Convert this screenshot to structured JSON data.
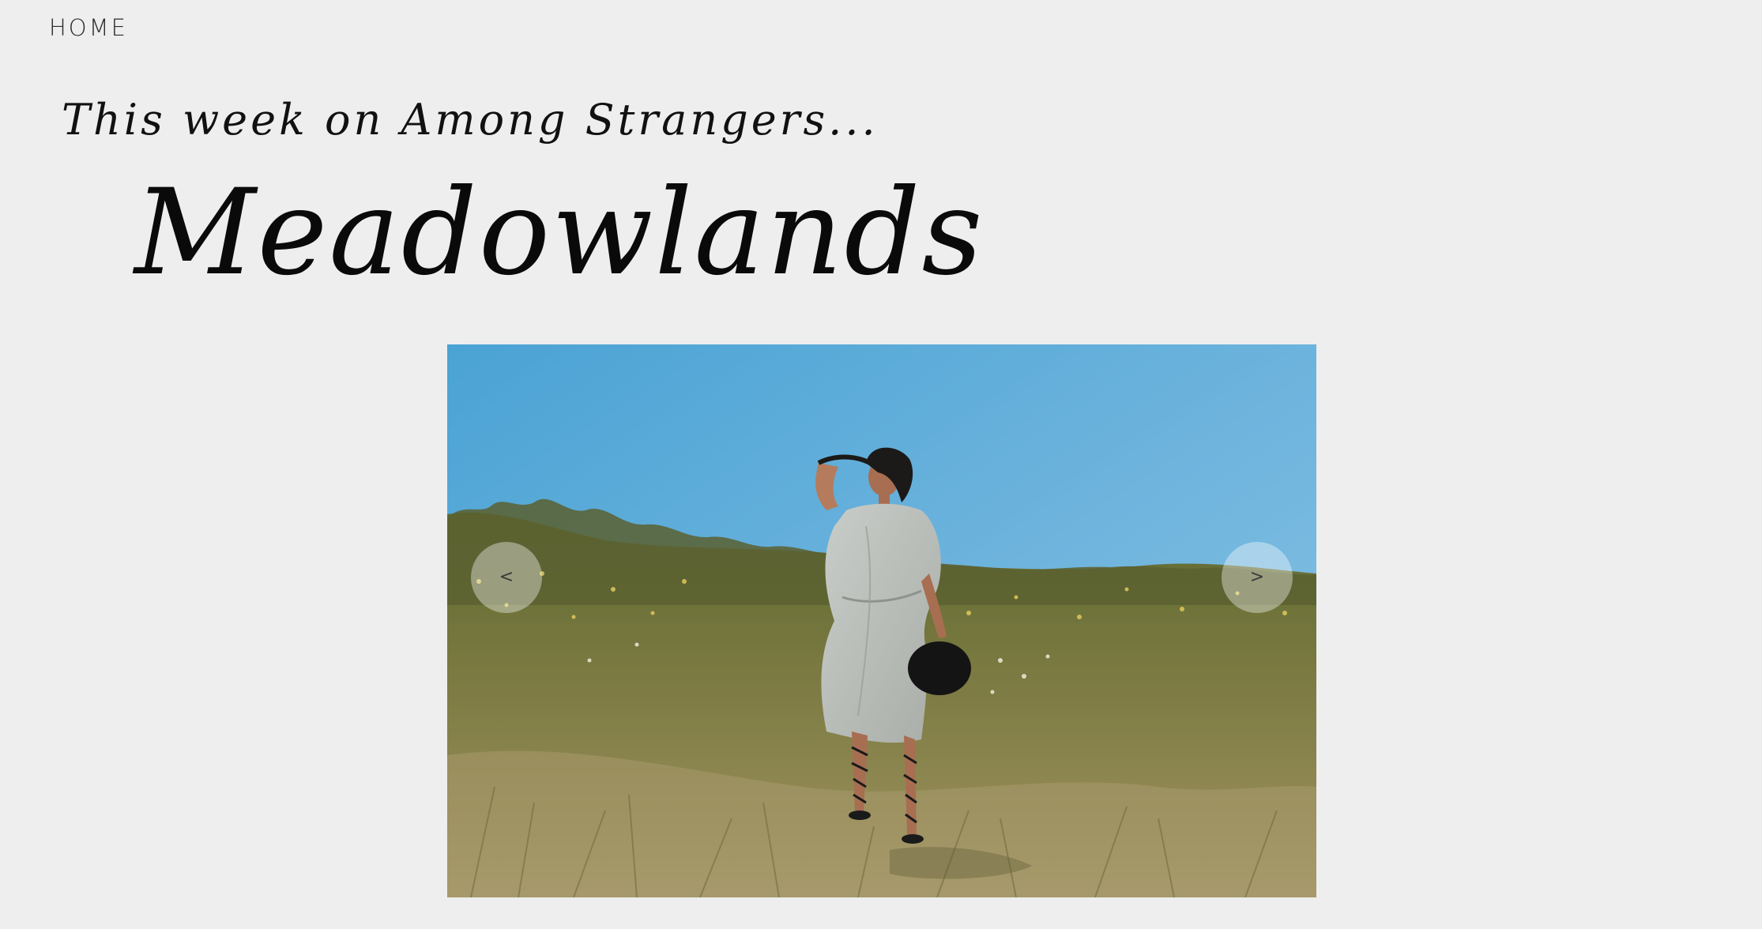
{
  "nav": {
    "home_label": "HOME"
  },
  "header": {
    "subtitle": "This week on Among Strangers...",
    "title": "Meadowlands"
  },
  "slideshow": {
    "prev_glyph": "<",
    "next_glyph": ">",
    "image_icon": "photo-woman-in-meadow"
  },
  "colors": {
    "background": "#eeeeee",
    "sky_top": "#3a97c9",
    "sky_bottom": "#86bfe0",
    "grass": "#7b7a42"
  }
}
